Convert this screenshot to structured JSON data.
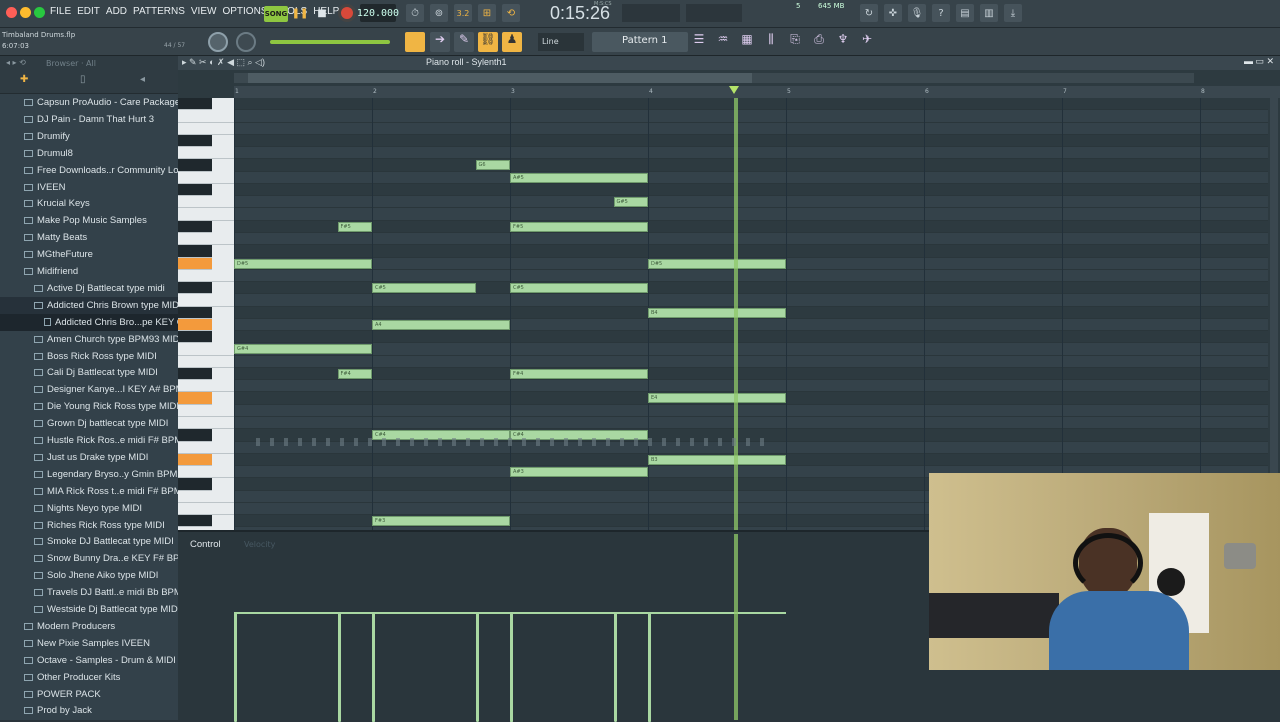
{
  "app": {
    "window_dots": [
      "#ff5f57",
      "#febc2e",
      "#28c840"
    ],
    "menu": [
      "FILE",
      "EDIT",
      "ADD",
      "PATTERNS",
      "VIEW",
      "OPTIONS",
      "TOOLS",
      "HELP"
    ]
  },
  "transport": {
    "song_label": "SONG",
    "tempo": "120.000",
    "time": "0:15:26",
    "time_unit": "M:S:CS",
    "pattern": "Pattern 1",
    "tool_label": "Line",
    "step_label": "3.2",
    "memory": "645 MB",
    "cpu_val": "5"
  },
  "project": {
    "file": "Timbaland Drums.flp",
    "time": "6:07:03",
    "counter": "44 / 57"
  },
  "browser": {
    "title": "Browser · All",
    "items": [
      {
        "label": "Capsun ProAudio - Care Package",
        "kind": "folder",
        "indent": 0
      },
      {
        "label": "DJ Pain - Damn That Hurt 3",
        "kind": "folder",
        "indent": 0
      },
      {
        "label": "Drumify",
        "kind": "folder",
        "indent": 0
      },
      {
        "label": "Drumul8",
        "kind": "folder",
        "indent": 0
      },
      {
        "label": "Free Downloads..r Community Loops",
        "kind": "folder",
        "indent": 0
      },
      {
        "label": "IVEEN",
        "kind": "folder",
        "indent": 0
      },
      {
        "label": "Krucial Keys",
        "kind": "folder",
        "indent": 0
      },
      {
        "label": "Make Pop Music Samples",
        "kind": "folder",
        "indent": 0
      },
      {
        "label": "Matty Beats",
        "kind": "folder",
        "indent": 0
      },
      {
        "label": "MGtheFuture",
        "kind": "folder",
        "indent": 0
      },
      {
        "label": "Midifriend",
        "kind": "folder",
        "indent": 0
      },
      {
        "label": "Active Dj Battlecat type midi",
        "kind": "folder",
        "indent": 1
      },
      {
        "label": "Addicted Chris Brown type MIDI",
        "kind": "folder",
        "indent": 1
      },
      {
        "label": "Addicted Chris Bro...pe KEY Cmin BPM95",
        "kind": "file",
        "indent": 2
      },
      {
        "label": "Amen Church type BPM93 MIDI",
        "kind": "folder",
        "indent": 1
      },
      {
        "label": "Boss Rick Ross type MIDI",
        "kind": "folder",
        "indent": 1
      },
      {
        "label": "Cali Dj Battlecat type MIDI",
        "kind": "folder",
        "indent": 1
      },
      {
        "label": "Designer Kanye...I KEY A# BPM145",
        "kind": "folder",
        "indent": 1
      },
      {
        "label": "Die Young Rick Ross type MIDI",
        "kind": "folder",
        "indent": 1
      },
      {
        "label": "Grown Dj battlecat type MIDI",
        "kind": "folder",
        "indent": 1
      },
      {
        "label": "Hustle Rick Ros..e midi F# BPM93",
        "kind": "folder",
        "indent": 1
      },
      {
        "label": "Just us Drake type MIDI",
        "kind": "folder",
        "indent": 1
      },
      {
        "label": "Legendary Bryso..y Gmin BPM140",
        "kind": "folder",
        "indent": 1
      },
      {
        "label": "MIA Rick Ross t..e midi F# BPM93",
        "kind": "folder",
        "indent": 1
      },
      {
        "label": "Nights Neyo type MIDI",
        "kind": "folder",
        "indent": 1
      },
      {
        "label": "Riches Rick Ross type MIDI",
        "kind": "folder",
        "indent": 1
      },
      {
        "label": "Smoke DJ Battlecat type MIDI",
        "kind": "folder",
        "indent": 1
      },
      {
        "label": "Snow Bunny Dra..e KEY F# BPM90",
        "kind": "folder",
        "indent": 1
      },
      {
        "label": "Solo Jhene Aiko type MIDI",
        "kind": "folder",
        "indent": 1
      },
      {
        "label": "Travels DJ Battl..e midi Bb BPM93",
        "kind": "folder",
        "indent": 1
      },
      {
        "label": "Westside Dj Battlecat type MIDI",
        "kind": "folder",
        "indent": 1
      },
      {
        "label": "Modern Producers",
        "kind": "folder",
        "indent": 0
      },
      {
        "label": "New Pixie Samples IVEEN",
        "kind": "folder",
        "indent": 0
      },
      {
        "label": "Octave - Samples - Drum & MIDI Kit",
        "kind": "folder",
        "indent": 0
      },
      {
        "label": "Other Producer Kits",
        "kind": "folder",
        "indent": 0
      },
      {
        "label": "POWER PACK",
        "kind": "folder",
        "indent": 0
      },
      {
        "label": "Prod by Jack",
        "kind": "folder",
        "indent": 0
      }
    ]
  },
  "piano_roll": {
    "title": "Piano roll - Sylenth1",
    "bars": [
      "1",
      "2",
      "3",
      "4",
      "5",
      "6",
      "7",
      "8"
    ],
    "control_label": "Control",
    "control_sub": "Velocity",
    "notes": [
      {
        "label": "G6",
        "bar": 2.75,
        "len": 0.25,
        "row": 5
      },
      {
        "label": "A#5",
        "bar": 3.0,
        "len": 1.0,
        "row": 6
      },
      {
        "label": "G#5",
        "bar": 3.75,
        "len": 0.25,
        "row": 8
      },
      {
        "label": "F#5",
        "bar": 1.75,
        "len": 0.25,
        "row": 10
      },
      {
        "label": "F#5",
        "bar": 3.0,
        "len": 1.0,
        "row": 10
      },
      {
        "label": "D#5",
        "bar": 1.0,
        "len": 1.0,
        "row": 13
      },
      {
        "label": "D#5",
        "bar": 4.0,
        "len": 1.0,
        "row": 13
      },
      {
        "label": "C#5",
        "bar": 2.0,
        "len": 0.75,
        "row": 15
      },
      {
        "label": "C#5",
        "bar": 3.0,
        "len": 1.0,
        "row": 15
      },
      {
        "label": "B4",
        "bar": 4.0,
        "len": 1.0,
        "row": 17
      },
      {
        "label": "A4",
        "bar": 2.0,
        "len": 1.0,
        "row": 18
      },
      {
        "label": "G#4",
        "bar": 1.0,
        "len": 1.0,
        "row": 20
      },
      {
        "label": "F#4",
        "bar": 1.75,
        "len": 0.25,
        "row": 22
      },
      {
        "label": "F#4",
        "bar": 3.0,
        "len": 1.0,
        "row": 22
      },
      {
        "label": "E4",
        "bar": 4.0,
        "len": 1.0,
        "row": 24
      },
      {
        "label": "C#4",
        "bar": 2.0,
        "len": 1.0,
        "row": 27
      },
      {
        "label": "C#4",
        "bar": 3.0,
        "len": 1.0,
        "row": 27
      },
      {
        "label": "B3",
        "bar": 4.0,
        "len": 1.0,
        "row": 29
      },
      {
        "label": "A#3",
        "bar": 3.0,
        "len": 1.0,
        "row": 30
      },
      {
        "label": "F#3",
        "bar": 2.0,
        "len": 1.0,
        "row": 34
      }
    ],
    "playhead_bar": 4.62
  },
  "webcam": {
    "desc_colors": [
      "#c4b182",
      "#3a6fa8",
      "#3b2a1f"
    ]
  }
}
